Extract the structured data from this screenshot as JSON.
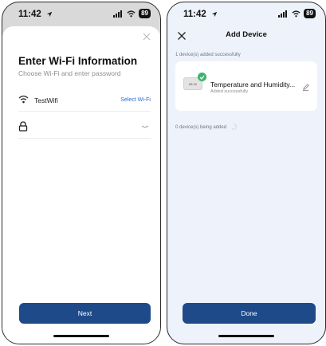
{
  "left_screen": {
    "status": {
      "time": "11:42",
      "battery": "89"
    },
    "title": "Enter Wi-Fi Information",
    "subtitle": "Choose Wi-Fi and enter password",
    "wifi": {
      "name": "TestWifi",
      "select_label": "Select Wi-Fi"
    },
    "password": {
      "value": ""
    },
    "next_label": "Next"
  },
  "right_screen": {
    "status": {
      "time": "11:42",
      "battery": "89"
    },
    "title": "Add Device",
    "added_label": "1 device(s) added successfully",
    "device": {
      "name": "Temperature and Humidity...",
      "status": "Added successfully",
      "thumb_text": "88.30"
    },
    "adding_label": "0 device(s) being added",
    "done_label": "Done"
  },
  "colors": {
    "primary": "#1e4a8a",
    "link": "#2b6cd6",
    "success": "#3db26a",
    "right_bg": "#eef3fb"
  },
  "icons": [
    "location-arrow-icon",
    "signal-icon",
    "wifi-icon",
    "battery-icon",
    "close-icon",
    "lock-icon",
    "eye-hidden-icon",
    "check-icon",
    "pencil-icon",
    "spinner-icon"
  ]
}
